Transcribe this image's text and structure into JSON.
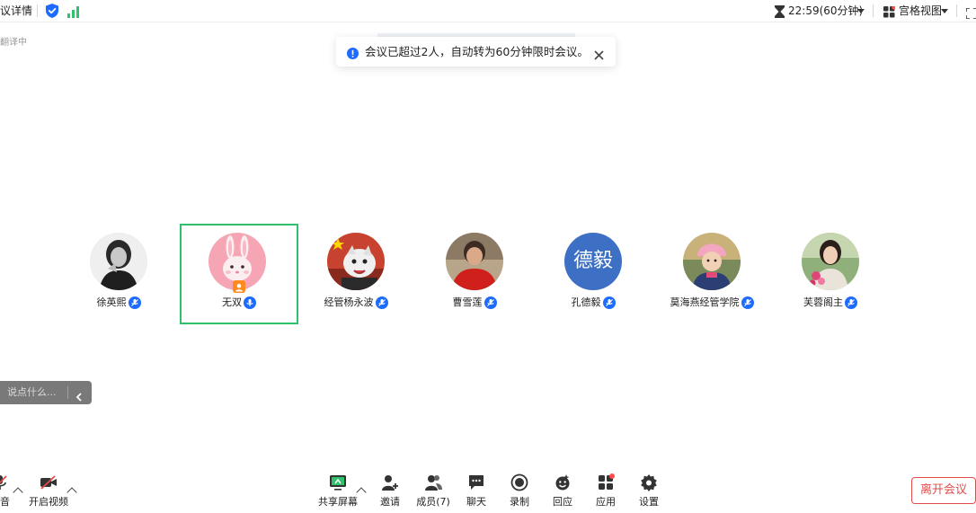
{
  "topbar": {
    "meeting_details": "议详情",
    "timer": "22:59(60分钟)",
    "view_mode": "宫格视图"
  },
  "status": {
    "recording_text": "翻译中"
  },
  "toast": {
    "message": "会议已超过2人，自动转为60分钟限时会议。"
  },
  "participants": [
    {
      "name": "徐英熙",
      "avatar": "portrait-photo-bw"
    },
    {
      "name": "无双",
      "avatar": "pink-rabbit",
      "active": true
    },
    {
      "name": "经管杨永波",
      "avatar": "cartoon-with-flag"
    },
    {
      "name": "曹雪莲",
      "avatar": "portrait-photo-red"
    },
    {
      "name": "孔德毅",
      "avatar_text": "德毅",
      "avatar_color": "#3d6fc4"
    },
    {
      "name": "莫海燕经管学院",
      "avatar": "child-photo-pink-hat"
    },
    {
      "name": "芙蓉阁主",
      "avatar": "portrait-photo-flowers"
    }
  ],
  "chat": {
    "placeholder": "说点什么..."
  },
  "toolbar": {
    "mute": "静音",
    "start_video": "开启视频",
    "share_screen": "共享屏幕",
    "invite": "邀请",
    "members": "成员(7)",
    "chat": "聊天",
    "record": "录制",
    "react": "回应",
    "apps": "应用",
    "settings": "设置",
    "leave": "离开会议"
  },
  "colors": {
    "active_border": "#2fc16b",
    "accent_blue": "#1e6bff",
    "leave_red": "#e24b4b",
    "security_blue": "#1e6bff",
    "signal_green": "#2fc16b"
  }
}
